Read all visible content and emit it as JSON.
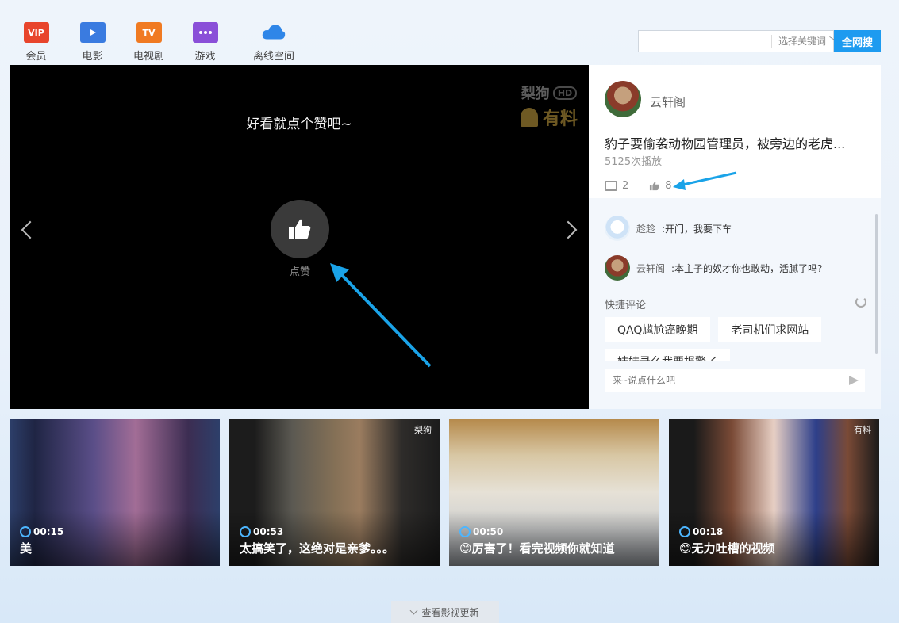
{
  "nav": {
    "items": [
      {
        "label": "会员",
        "icon": "vip-icon",
        "badge": "VIP",
        "color": "#e8452c"
      },
      {
        "label": "电影",
        "icon": "movie-icon",
        "badge": "",
        "color": "#3a7be0"
      },
      {
        "label": "电视剧",
        "icon": "tv-icon",
        "badge": "TV",
        "color": "#f07a22"
      },
      {
        "label": "游戏",
        "icon": "game-icon",
        "badge": "",
        "color": "#8a4fd8"
      },
      {
        "label": "离线空间",
        "icon": "cloud-icon",
        "badge": "",
        "color": "#2f86e8"
      }
    ]
  },
  "search": {
    "placeholder": "",
    "keyword_select": "选择关键词",
    "button": "全网搜"
  },
  "player": {
    "caption": "好看就点个赞吧~",
    "like_label": "点赞",
    "watermark_top": "梨狗",
    "watermark_hd": "HD",
    "watermark_bottom": "有料"
  },
  "video": {
    "author": "云轩阁",
    "title": "豹子要偷袭动物园管理员，被旁边的老虎...",
    "plays": "5125次播放",
    "comment_count": "2",
    "like_count": "8"
  },
  "comments": [
    {
      "name": "趁趁",
      "text": ":开门，我要下车"
    },
    {
      "name": "云轩阁",
      "text": ":本主子的奴才你也敢动，活腻了吗?"
    }
  ],
  "quick_comment": {
    "heading": "快捷评论",
    "chips": [
      "QAQ尴尬癌晚期",
      "老司机们求网站",
      "妹妹录么我要报警了"
    ]
  },
  "comment_input": {
    "placeholder": "来~说点什么吧"
  },
  "thumbs": [
    {
      "duration": "00:15",
      "title": "美",
      "tag": ""
    },
    {
      "duration": "00:53",
      "title": "太搞笑了，这绝对是亲爹。。。",
      "tag": "梨狗"
    },
    {
      "duration": "00:50",
      "title": "😊厉害了！看完视频你就知道",
      "tag": ""
    },
    {
      "duration": "00:18",
      "title": "😊无力吐槽的视频",
      "tag": "有料"
    }
  ],
  "more_button": "查看影视更新",
  "colors": {
    "accent": "#1d9bf0",
    "annotation_arrow": "#1aa3e8"
  }
}
